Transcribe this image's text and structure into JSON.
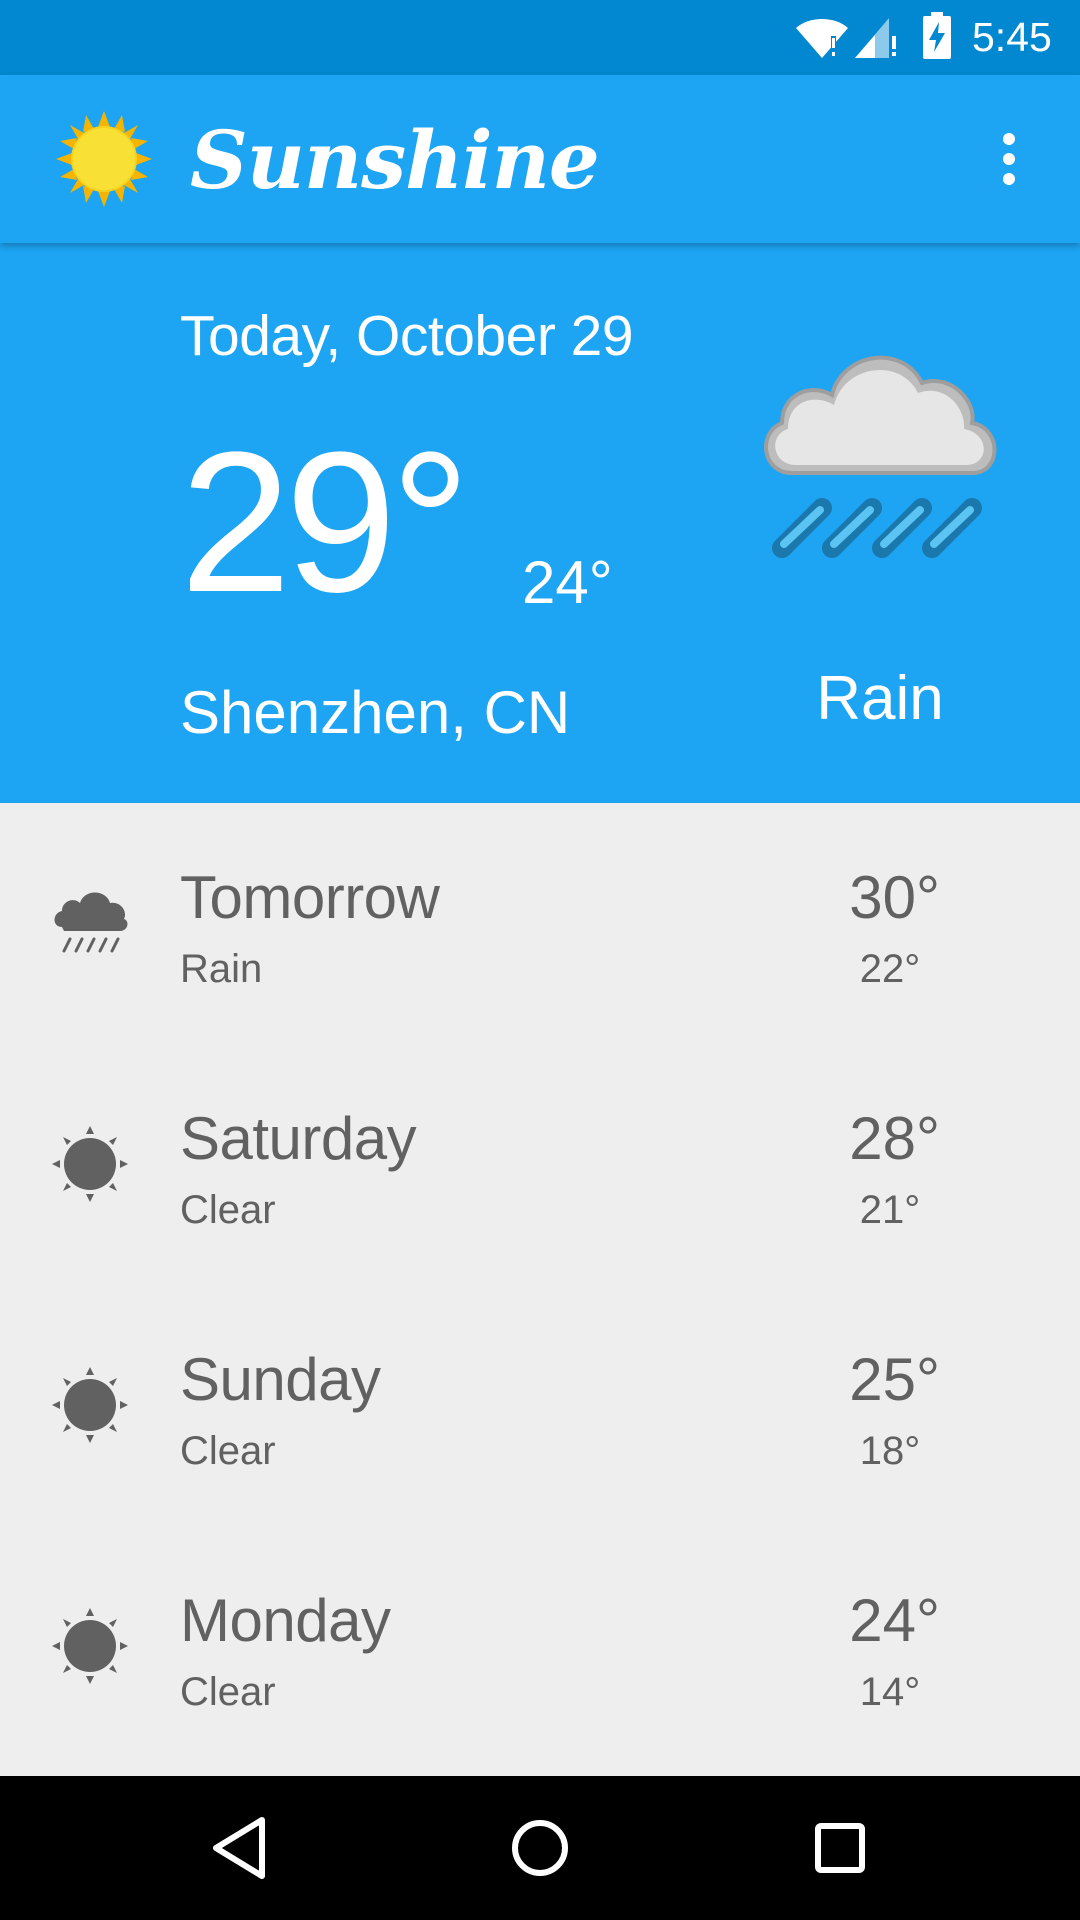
{
  "status_bar": {
    "time": "5:45",
    "icons": [
      "wifi-alert-icon",
      "cellular-alert-icon",
      "battery-charging-icon"
    ]
  },
  "app_bar": {
    "title": "Sunshine",
    "logo_icon": "sun-icon",
    "overflow_icon": "more-vert-icon"
  },
  "today": {
    "date": "Today, October 29",
    "high": "29°",
    "low": "24°",
    "location": "Shenzhen, CN",
    "condition": "Rain",
    "art_icon": "rain-cloud-art"
  },
  "forecast": [
    {
      "day": "Tomorrow",
      "desc": "Rain",
      "high": "30°",
      "low": "22°",
      "icon": "rain-icon"
    },
    {
      "day": "Saturday",
      "desc": "Clear",
      "high": "28°",
      "low": "21°",
      "icon": "clear-icon"
    },
    {
      "day": "Sunday",
      "desc": "Clear",
      "high": "25°",
      "low": "18°",
      "icon": "clear-icon"
    },
    {
      "day": "Monday",
      "desc": "Clear",
      "high": "24°",
      "low": "14°",
      "icon": "clear-icon"
    }
  ],
  "nav_bar": {
    "buttons": [
      "back-icon",
      "home-icon",
      "recents-icon"
    ]
  },
  "colors": {
    "primary": "#1da4f2",
    "primary_dark": "#0288d1",
    "list_background": "#eeeeee",
    "list_text": "#616161"
  }
}
